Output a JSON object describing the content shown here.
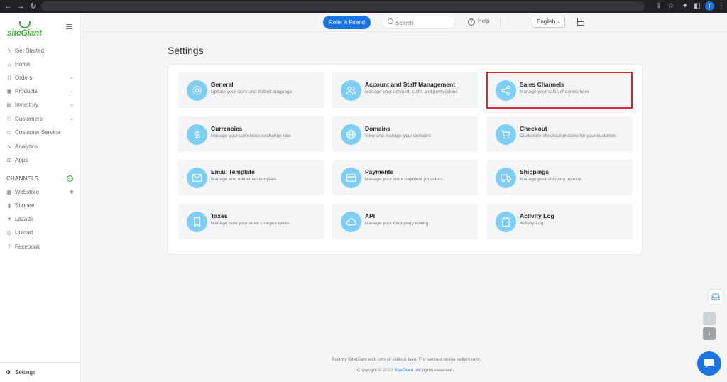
{
  "header": {
    "refer_label": "Refer A Friend",
    "search_placeholder": "Search",
    "help_label": "Help",
    "language": "English"
  },
  "browser": {
    "profile_initial": "T"
  },
  "sidebar": {
    "logo_text": "siteGiant",
    "nav": [
      {
        "label": "Get Started",
        "icon": "lightning-icon",
        "has_chevron": false
      },
      {
        "label": "Home",
        "icon": "home-icon",
        "has_chevron": false
      },
      {
        "label": "Orders",
        "icon": "clipboard-icon",
        "has_chevron": true
      },
      {
        "label": "Products",
        "icon": "box-icon",
        "has_chevron": true
      },
      {
        "label": "Inventory",
        "icon": "inventory-icon",
        "has_chevron": true
      },
      {
        "label": "Customers",
        "icon": "users-icon",
        "has_chevron": true
      },
      {
        "label": "Customer Service",
        "icon": "chat-icon",
        "has_chevron": false
      },
      {
        "label": "Analytics",
        "icon": "pulse-icon",
        "has_chevron": false
      },
      {
        "label": "Apps",
        "icon": "grid-icon",
        "has_chevron": false
      }
    ],
    "channels_label": "CHANNELS",
    "channels": [
      {
        "label": "Webstore",
        "icon": "store-icon"
      },
      {
        "label": "Shopee",
        "icon": "shopee-icon"
      },
      {
        "label": "Lazada",
        "icon": "lazada-icon"
      },
      {
        "label": "Unicart",
        "icon": "unicart-icon"
      },
      {
        "label": "Facebook",
        "icon": "facebook-icon"
      }
    ],
    "settings_label": "Settings"
  },
  "page": {
    "title": "Settings"
  },
  "cards": [
    {
      "title": "General",
      "desc": "Update your store and default language",
      "icon": "gear-icon"
    },
    {
      "title": "Account and Staff Management",
      "desc": "Manage your account, staffs and permissions",
      "icon": "users-icon"
    },
    {
      "title": "Sales Channels",
      "desc": "Manage your sales channels here",
      "icon": "share-icon"
    },
    {
      "title": "Currencies",
      "desc": "Manage your currencies exchange rate",
      "icon": "dollar-icon"
    },
    {
      "title": "Domains",
      "desc": "View and manage your domains",
      "icon": "globe-icon"
    },
    {
      "title": "Checkout",
      "desc": "Customize checkout process for your customer.",
      "icon": "cart-icon"
    },
    {
      "title": "Email Template",
      "desc": "Manage and edit email template",
      "icon": "mail-icon"
    },
    {
      "title": "Payments",
      "desc": "Manage your store payment providers.",
      "icon": "card-icon"
    },
    {
      "title": "Shippings",
      "desc": "Manage your shipping options.",
      "icon": "truck-icon"
    },
    {
      "title": "Taxes",
      "desc": "Manage how your store charges taxes.",
      "icon": "bookmark-icon"
    },
    {
      "title": "API",
      "desc": "Manage your third-party linking",
      "icon": "cloud-icon"
    },
    {
      "title": "Activity Log",
      "desc": "Activity Log",
      "icon": "clipboard-icon"
    }
  ],
  "footer": {
    "line1": "Built by SiteGiant with lot's of skills & love. For serious online sellers only.",
    "copyright_prefix": "Copyright © 2022 ",
    "copyright_link": "SiteGiant",
    "copyright_suffix": ". All rights reserved."
  },
  "colors": {
    "accent": "#1b74e4",
    "icon_bg": "#7fcef5",
    "highlight": "#e0262d",
    "brand_green": "#3aa935"
  }
}
